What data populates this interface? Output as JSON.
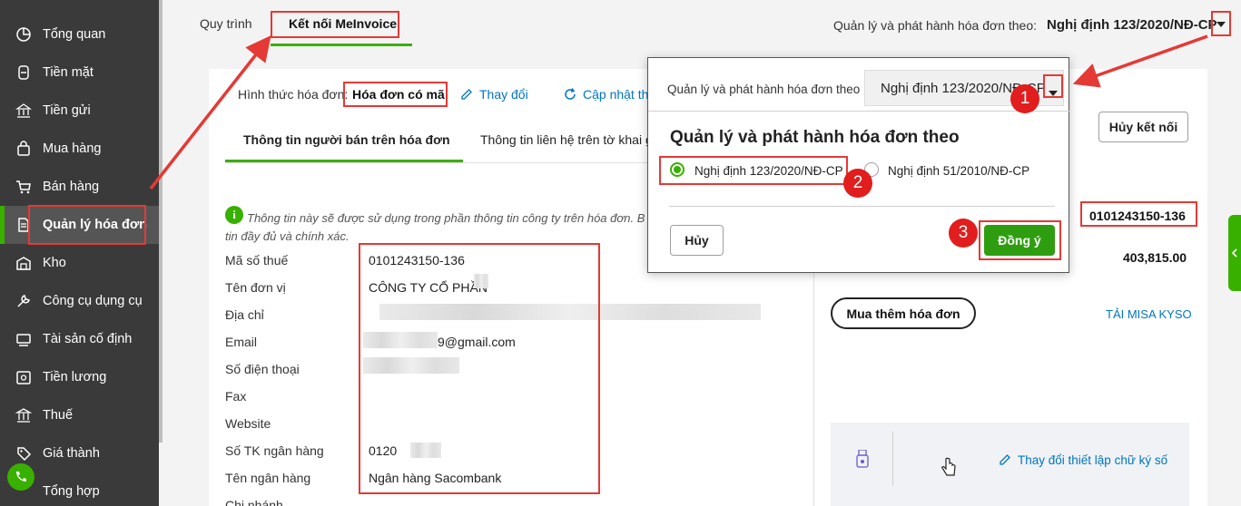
{
  "sidebar": {
    "items": [
      {
        "label": "Tổng quan",
        "icon": "dashboard-icon"
      },
      {
        "label": "Tiền mặt",
        "icon": "cash-icon"
      },
      {
        "label": "Tiền gửi",
        "icon": "bank-icon"
      },
      {
        "label": "Mua hàng",
        "icon": "purchase-bag-icon"
      },
      {
        "label": "Bán hàng",
        "icon": "cart-icon"
      },
      {
        "label": "Quản lý hóa đơn",
        "icon": "invoice-icon",
        "active": true
      },
      {
        "label": "Kho",
        "icon": "warehouse-icon"
      },
      {
        "label": "Công cụ dụng cụ",
        "icon": "tools-icon"
      },
      {
        "label": "Tài sản cố định",
        "icon": "asset-icon"
      },
      {
        "label": "Tiền lương",
        "icon": "salary-icon"
      },
      {
        "label": "Thuế",
        "icon": "tax-icon"
      },
      {
        "label": "Giá thành",
        "icon": "cost-icon"
      },
      {
        "label": "Tổng hợp",
        "icon": "summary-icon"
      }
    ]
  },
  "tabs": {
    "process": "Quy trình",
    "connect": "Kết nối MeInvoice"
  },
  "decree": {
    "label": "Quản lý và phát hành hóa đơn theo:",
    "value": "Nghị định 123/2020/NĐ-CP"
  },
  "invoice_form": {
    "label": "Hình thức hóa đơn:",
    "value": "Hóa đơn có mã",
    "change_link": "Thay đổi",
    "update_link": "Cập nhật th"
  },
  "sub_tabs": {
    "seller": "Thông tin người bán trên hóa đơn",
    "contact": "Thông tin liên hệ trên tờ khai g"
  },
  "info_note": {
    "line1": "Thông tin này sẽ được sử dụng trong phần thông tin công ty trên hóa đơn. B",
    "line2": "tin đầy đủ và chính xác."
  },
  "fields": [
    {
      "label": "Mã số thuế",
      "value": "0101243150-136"
    },
    {
      "label": "Tên đơn vị",
      "value": "CÔNG TY CỔ PHẦN"
    },
    {
      "label": "Địa chỉ",
      "value": ""
    },
    {
      "label": "Email",
      "value": "9@gmail.com"
    },
    {
      "label": "Số điện thoại",
      "value": ""
    },
    {
      "label": "Fax",
      "value": ""
    },
    {
      "label": "Website",
      "value": ""
    },
    {
      "label": "Số TK ngân hàng",
      "value": "0120"
    },
    {
      "label": "Tên ngân hàng",
      "value": "Ngân hàng Sacombank"
    },
    {
      "label": "Chi nhánh",
      "value": ""
    }
  ],
  "right_panel": {
    "disconnect": "Hủy kết nối",
    "tax_code": "0101243150-136",
    "amount": "403,815.00",
    "buy_more": "Mua thêm hóa đơn",
    "download_kyso": "TẢI MISA KYSO",
    "change_signature": "Thay đổi thiết lập chữ ký số"
  },
  "popup": {
    "head_label": "Quản lý và phát hành hóa đơn theo",
    "head_value": "Nghị định 123/2020/NĐ-CP",
    "title": "Quản lý và phát hành hóa đơn theo",
    "options": [
      {
        "label": "Nghị định 123/2020/NĐ-CP",
        "checked": true
      },
      {
        "label": "Nghị định 51/2010/NĐ-CP",
        "checked": false
      }
    ],
    "cancel": "Hủy",
    "ok": "Đồng ý"
  },
  "badges": {
    "one": "1",
    "two": "2",
    "three": "3"
  },
  "colors": {
    "accent": "#38b000",
    "annotation": "#e53935",
    "link": "#0075c0",
    "sidebar": "#3a3a3a"
  }
}
